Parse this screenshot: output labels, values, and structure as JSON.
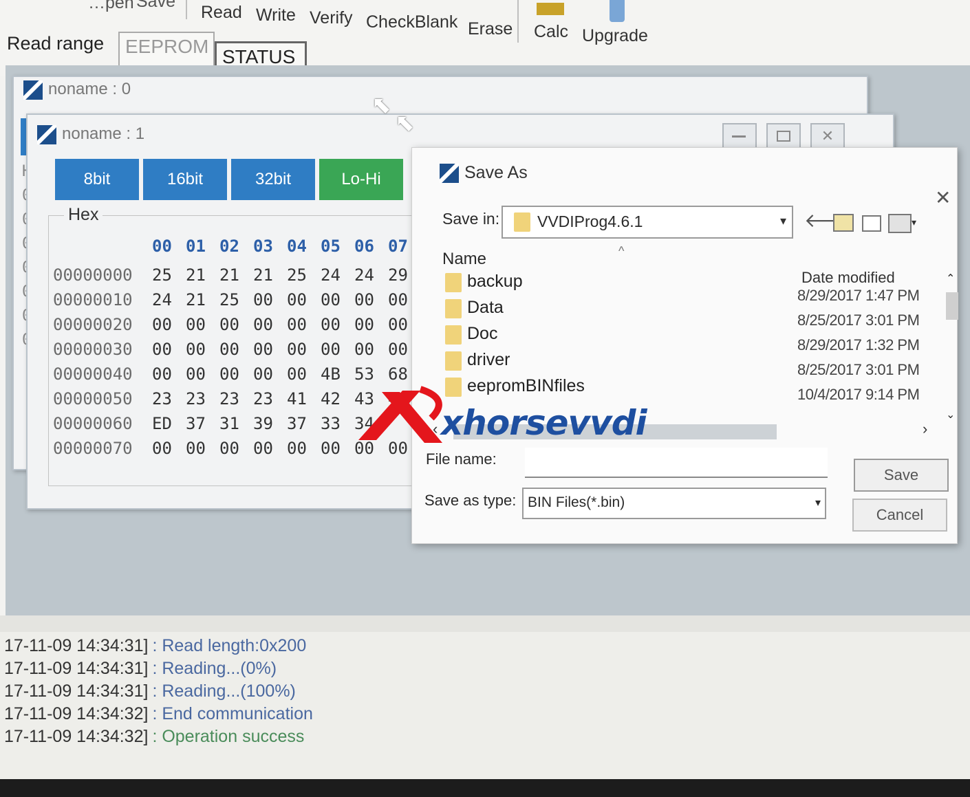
{
  "toolbar": {
    "partial_items": [
      "…pen",
      "Save"
    ],
    "items": [
      "Read",
      "Write",
      "Verify",
      "CheckBlank",
      "Erase"
    ],
    "tools": [
      "Calc",
      "Upgrade"
    ]
  },
  "read_range": {
    "label": "Read range",
    "options": [
      "EEPROM",
      "STATUS"
    ]
  },
  "windows": {
    "back_title": "noname : 0",
    "front_title": "noname : 1"
  },
  "hex_view": {
    "tabs": [
      "8bit",
      "16bit",
      "32bit",
      "Lo-Hi"
    ],
    "group_label": "Hex",
    "col_headers": [
      "00",
      "01",
      "02",
      "03",
      "04",
      "05",
      "06",
      "07"
    ],
    "rows": [
      {
        "addr": "00000000",
        "bytes": [
          "25",
          "21",
          "21",
          "21",
          "25",
          "24",
          "24",
          "29"
        ]
      },
      {
        "addr": "00000010",
        "bytes": [
          "24",
          "21",
          "25",
          "00",
          "00",
          "00",
          "00",
          "00"
        ]
      },
      {
        "addr": "00000020",
        "bytes": [
          "00",
          "00",
          "00",
          "00",
          "00",
          "00",
          "00",
          "00"
        ]
      },
      {
        "addr": "00000030",
        "bytes": [
          "00",
          "00",
          "00",
          "00",
          "00",
          "00",
          "00",
          "00"
        ]
      },
      {
        "addr": "00000040",
        "bytes": [
          "00",
          "00",
          "00",
          "00",
          "00",
          "4B",
          "53",
          "68"
        ]
      },
      {
        "addr": "00000050",
        "bytes": [
          "23",
          "23",
          "23",
          "23",
          "41",
          "42",
          "43",
          "4"
        ]
      },
      {
        "addr": "00000060",
        "bytes": [
          "ED",
          "37",
          "31",
          "39",
          "37",
          "33",
          "34",
          ""
        ]
      },
      {
        "addr": "00000070",
        "bytes": [
          "00",
          "00",
          "00",
          "00",
          "00",
          "00",
          "00",
          "00"
        ]
      }
    ]
  },
  "save_dialog": {
    "title": "Save As",
    "save_in_label": "Save in:",
    "save_in_value": "VVDIProg4.6.1",
    "col_name": "Name",
    "col_date": "Date modified",
    "files": [
      {
        "name": "backup",
        "date": "8/29/2017 1:47 PM"
      },
      {
        "name": "Data",
        "date": "8/25/2017 3:01 PM"
      },
      {
        "name": "Doc",
        "date": "8/29/2017 1:32 PM"
      },
      {
        "name": "driver",
        "date": "8/25/2017 3:01 PM"
      },
      {
        "name": "eepromBINfiles",
        "date": "10/4/2017 9:14 PM"
      }
    ],
    "file_name_label": "File name:",
    "file_name_value": "",
    "type_label": "Save as type:",
    "type_value": "BIN Files(*.bin)",
    "save_button": "Save",
    "cancel_button": "Cancel"
  },
  "watermark": "xhorsevvdi",
  "log": [
    {
      "ts": "17-11-09 14:34:31]",
      "msg": ": Read length:0x200"
    },
    {
      "ts": "17-11-09 14:34:31]",
      "msg": ": Reading...(0%)"
    },
    {
      "ts": "17-11-09 14:34:31]",
      "msg": ": Reading...(100%)"
    },
    {
      "ts": "17-11-09 14:34:32]",
      "msg": ": End communication"
    },
    {
      "ts": "17-11-09 14:34:32]",
      "msg": ": Operation success"
    }
  ],
  "colors": {
    "tab_blue": "#2f7dc4",
    "tab_green": "#3aa655",
    "log_blue": "#4a68a0",
    "log_green": "#4a8c5a",
    "watermark_red": "#e4161c",
    "watermark_blue": "#1e4fa0"
  }
}
